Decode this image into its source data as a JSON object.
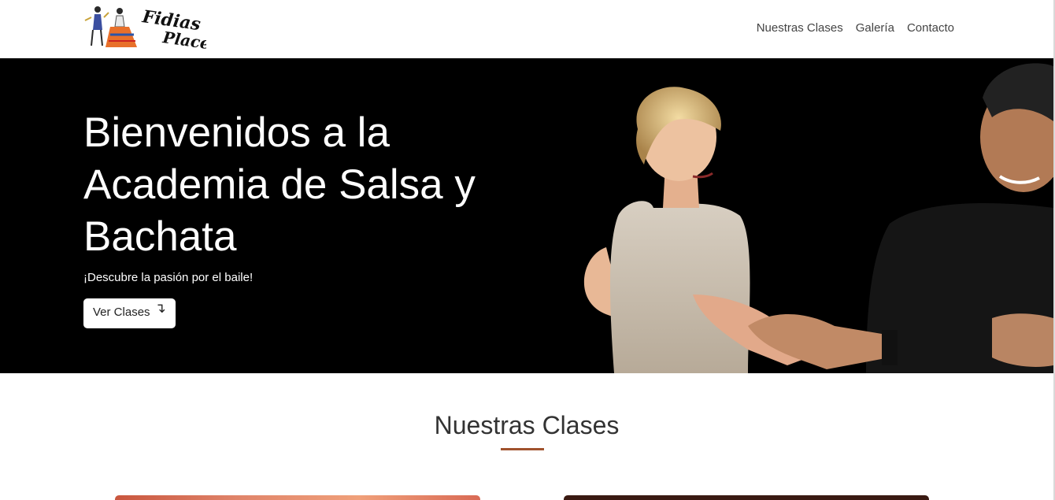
{
  "navbar": {
    "logo_text": "Fidias Place",
    "links": [
      {
        "label": "Nuestras Clases"
      },
      {
        "label": "Galería"
      },
      {
        "label": "Contacto"
      }
    ]
  },
  "hero": {
    "title": "Bienvenidos a la Academia de Salsa y Bachata",
    "subtitle": "¡Descubre la pasión por el baile!",
    "button_label": "Ver Clases",
    "button_icon": "arrow-down-icon"
  },
  "section": {
    "title": "Nuestras Clases",
    "accent_color": "#a0522d"
  }
}
